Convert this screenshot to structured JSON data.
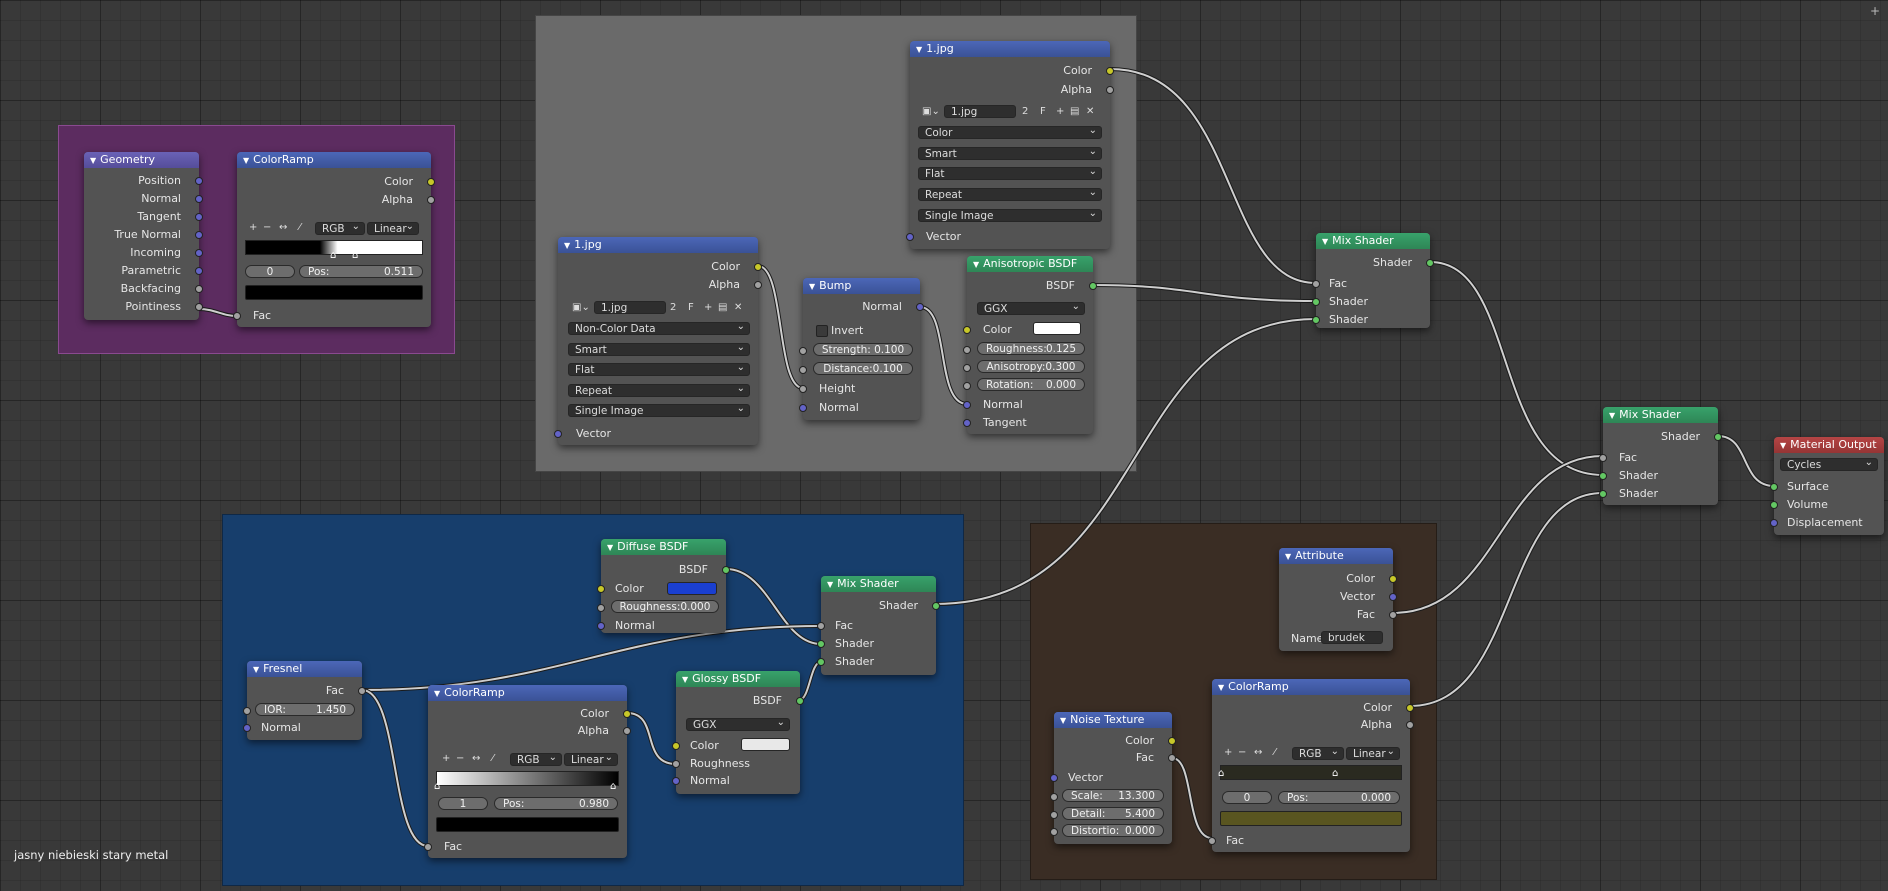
{
  "footer_label": "jasny niebieski stary metal",
  "colors": {
    "frame_purple": "#5c2c60",
    "frame_gray": "#6a6a6a",
    "frame_blue": "#173e6c",
    "frame_brown": "#3a2d24"
  },
  "geometry": {
    "title": "Geometry",
    "outputs": [
      "Position",
      "Normal",
      "Tangent",
      "True Normal",
      "Incoming",
      "Parametric",
      "Backfacing",
      "Pointiness"
    ]
  },
  "ramp1": {
    "title": "ColorRamp",
    "out_color": "Color",
    "out_alpha": "Alpha",
    "mode": "RGB",
    "interp": "Linear",
    "index": "0",
    "pos_label": "Pos:",
    "pos": "0.511",
    "fac": "Fac"
  },
  "img_top": {
    "title": "1.jpg",
    "out_color": "Color",
    "out_alpha": "Alpha",
    "file": "1.jpg",
    "users": "2",
    "fake": "F",
    "colorspace": "Color",
    "alpha": "Smart",
    "projection": "Flat",
    "extension": "Repeat",
    "source": "Single Image",
    "in_vector": "Vector"
  },
  "img_mid": {
    "title": "1.jpg",
    "out_color": "Color",
    "out_alpha": "Alpha",
    "file": "1.jpg",
    "users": "2",
    "fake": "F",
    "colorspace": "Non-Color Data",
    "alpha": "Smart",
    "projection": "Flat",
    "extension": "Repeat",
    "source": "Single Image",
    "in_vector": "Vector"
  },
  "bump": {
    "title": "Bump",
    "out_normal": "Normal",
    "invert": "Invert",
    "strength": "Strength: 0.100",
    "distance": "Distance:0.100",
    "in_height": "Height",
    "in_normal": "Normal"
  },
  "aniso": {
    "title": "Anisotropic BSDF",
    "out": "BSDF",
    "distribution": "GGX",
    "color": "Color",
    "color_hex": "#ffffff",
    "roughness": "Roughness:",
    "roughness_val": "0.125",
    "anisotropy": "Anisotropy:0.300",
    "rotation": "Rotation:",
    "rotation_val": "0.000",
    "normal": "Normal",
    "tangent": "Tangent"
  },
  "mix1": {
    "title": "Mix Shader",
    "out": "Shader",
    "fac": "Fac",
    "sh1": "Shader",
    "sh2": "Shader"
  },
  "mix2": {
    "title": "Mix Shader",
    "out": "Shader",
    "fac": "Fac",
    "sh1": "Shader",
    "sh2": "Shader"
  },
  "matout": {
    "title": "Material Output",
    "engine": "Cycles",
    "surface": "Surface",
    "volume": "Volume",
    "displacement": "Displacement"
  },
  "diffuse": {
    "title": "Diffuse BSDF",
    "out": "BSDF",
    "color": "Color",
    "color_hex": "#1a3fd0",
    "roughness": "Roughness:0.000",
    "normal": "Normal"
  },
  "mix3": {
    "title": "Mix Shader",
    "out": "Shader",
    "fac": "Fac",
    "sh1": "Shader",
    "sh2": "Shader"
  },
  "fresnel": {
    "title": "Fresnel",
    "out": "Fac",
    "ior_label": "IOR:",
    "ior": "1.450",
    "normal": "Normal"
  },
  "ramp2": {
    "title": "ColorRamp",
    "out_color": "Color",
    "out_alpha": "Alpha",
    "mode": "RGB",
    "interp": "Linear",
    "index": "1",
    "pos_label": "Pos:",
    "pos": "0.980",
    "fac": "Fac"
  },
  "glossy": {
    "title": "Glossy BSDF",
    "out": "BSDF",
    "distribution": "GGX",
    "color": "Color",
    "color_hex": "#e8e8e8",
    "roughness": "Roughness",
    "normal": "Normal"
  },
  "attribute": {
    "title": "Attribute",
    "color": "Color",
    "vector": "Vector",
    "fac": "Fac",
    "name_label": "Name",
    "name": "brudek"
  },
  "ramp3": {
    "title": "ColorRamp",
    "out_color": "Color",
    "out_alpha": "Alpha",
    "mode": "RGB",
    "interp": "Linear",
    "index": "0",
    "pos_label": "Pos:",
    "pos": "0.000",
    "fac": "Fac"
  },
  "noise": {
    "title": "Noise Texture",
    "out_color": "Color",
    "out_fac": "Fac",
    "vector": "Vector",
    "scale_label": "Scale:",
    "scale": "13.300",
    "detail_label": "Detail:",
    "detail": "5.400",
    "distortion_label": "Distortio:",
    "distortion": "0.000"
  }
}
